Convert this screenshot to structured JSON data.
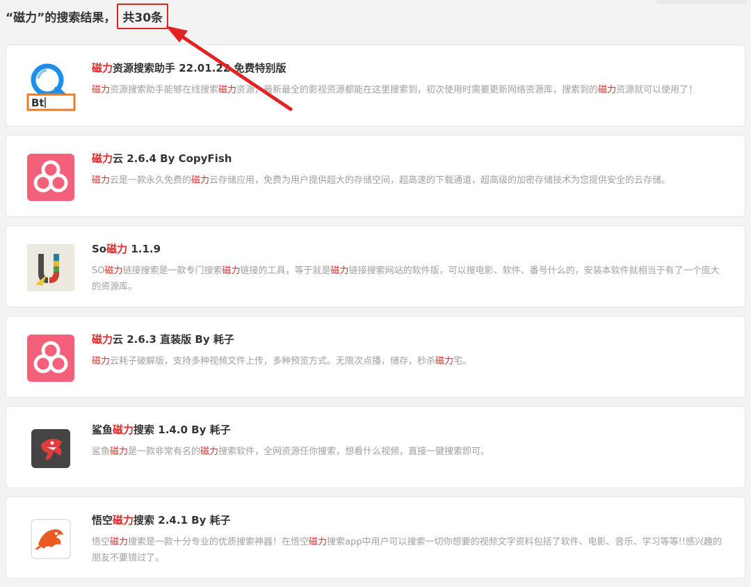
{
  "header": {
    "prefix": "“磁力”的搜索结果，",
    "count": "共30条"
  },
  "accent_color": "#e02a2a",
  "results": [
    {
      "icon": "magnet-search-bt-icon",
      "title": [
        {
          "t": "磁力",
          "h": true
        },
        {
          "t": "资源搜索助手 22.01.22 免费特别版",
          "h": false
        }
      ],
      "desc": [
        {
          "t": "磁力",
          "h": true
        },
        {
          "t": "资源搜索助手能够在线搜索",
          "h": false
        },
        {
          "t": "磁力",
          "h": true
        },
        {
          "t": "资源，最新最全的影视资源都能在这里搜索到，初次使用时需要更新网络资源库，搜索到的",
          "h": false
        },
        {
          "t": "磁力",
          "h": true
        },
        {
          "t": "资源就可以使用了！",
          "h": false
        }
      ]
    },
    {
      "icon": "cloud-app-icon",
      "title": [
        {
          "t": "磁力",
          "h": true
        },
        {
          "t": "云 2.6.4 By CopyFish",
          "h": false
        }
      ],
      "desc": [
        {
          "t": "磁力",
          "h": true
        },
        {
          "t": "云是一款永久免费的",
          "h": false
        },
        {
          "t": "磁力",
          "h": true
        },
        {
          "t": "云存储应用，免费为用户提供超大的存储空间，超高速的下载通道，超高级的加密存储技术为您提供安全的云存储。",
          "h": false
        }
      ]
    },
    {
      "icon": "so-magnet-icon",
      "title": [
        {
          "t": "So",
          "h": false
        },
        {
          "t": "磁力",
          "h": true
        },
        {
          "t": " 1.1.9",
          "h": false
        }
      ],
      "desc": [
        {
          "t": "SO",
          "h": false
        },
        {
          "t": "磁力",
          "h": true
        },
        {
          "t": "链接搜索是一款专门搜索",
          "h": false
        },
        {
          "t": "磁力",
          "h": true
        },
        {
          "t": "链接的工具，等于就是",
          "h": false
        },
        {
          "t": "磁力",
          "h": true
        },
        {
          "t": "链接搜索网站的软件版，可以搜电影、软件、番号什么的，安装本软件就相当于有了一个庞大的资源库。",
          "h": false
        }
      ]
    },
    {
      "icon": "cloud-app-icon",
      "title": [
        {
          "t": "磁力",
          "h": true
        },
        {
          "t": "云 2.6.3 直装版 By 耗子",
          "h": false
        }
      ],
      "desc": [
        {
          "t": "磁力",
          "h": true
        },
        {
          "t": "云耗子破解版，支持多种视频文件上传，多种预览方式。无限次点播，储存，秒杀",
          "h": false
        },
        {
          "t": "磁力",
          "h": true
        },
        {
          "t": "宅。",
          "h": false
        }
      ]
    },
    {
      "icon": "shark-icon",
      "title": [
        {
          "t": "鲨鱼",
          "h": false
        },
        {
          "t": "磁力",
          "h": true
        },
        {
          "t": "搜索 1.4.0 By 耗子",
          "h": false
        }
      ],
      "desc": [
        {
          "t": "鲨鱼",
          "h": false
        },
        {
          "t": "磁力",
          "h": true
        },
        {
          "t": "是一款非常有名的",
          "h": false
        },
        {
          "t": "磁力",
          "h": true
        },
        {
          "t": "搜索软件，全网资源任你搜索，想看什么视频，直接一键搜索即可。",
          "h": false
        }
      ]
    },
    {
      "icon": "wukong-icon",
      "title": [
        {
          "t": "悟空",
          "h": false
        },
        {
          "t": "磁力",
          "h": true
        },
        {
          "t": "搜索 2.4.1 By 耗子",
          "h": false
        }
      ],
      "desc": [
        {
          "t": "悟空",
          "h": false
        },
        {
          "t": "磁力",
          "h": true
        },
        {
          "t": "搜索是一款十分专业的优质搜索神器！在悟空",
          "h": false
        },
        {
          "t": "磁力",
          "h": true
        },
        {
          "t": "搜索app中用户可以搜索一切你想要的视频文字资料包括了软件、电影、音乐、学习等等!!感兴趣的朋友不要错过了。",
          "h": false
        }
      ]
    }
  ]
}
